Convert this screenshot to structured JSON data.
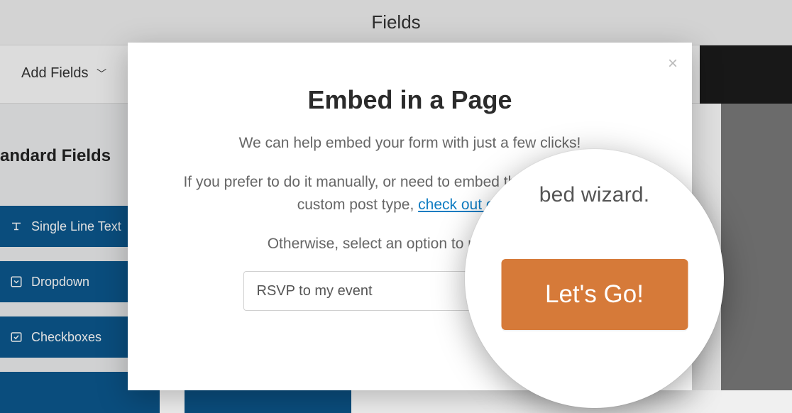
{
  "bg": {
    "header_title": "Fields",
    "add_fields_label": "Add Fields",
    "section_label": "andard Fields",
    "fields": {
      "single_line": "Single Line Text",
      "dropdown": "Dropdown",
      "checkboxes": "Checkboxes"
    }
  },
  "modal": {
    "title": "Embed in a Page",
    "line1": "We can help embed your form with just a few clicks!",
    "line2a": "If you prefer to do it manually, or need to embed the form in a post or custom post type, ",
    "line2_link": "check out our vi",
    "line3": "Otherwise, select an option to proceed with",
    "input_value": "RSVP to my event",
    "close": "×"
  },
  "lens": {
    "text": "bed wizard.",
    "button": "Let's Go!"
  }
}
